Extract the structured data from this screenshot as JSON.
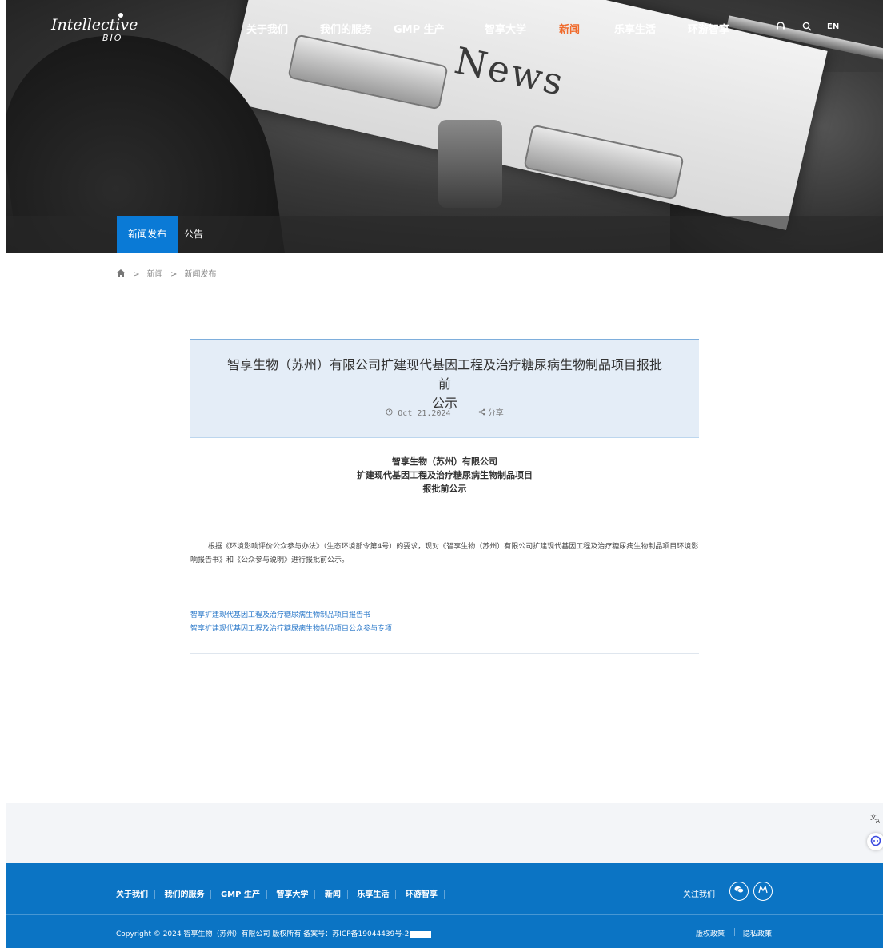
{
  "header": {
    "logo": {
      "text": "Intellective",
      "sub": "BIO"
    },
    "nav": [
      {
        "label": "关于我们",
        "active": false
      },
      {
        "label": "我们的服务",
        "active": false
      },
      {
        "label": "GMP 生产",
        "active": false
      },
      {
        "label": "智享大学",
        "active": false
      },
      {
        "label": "新闻",
        "active": true
      },
      {
        "label": "乐享生活",
        "active": false
      },
      {
        "label": "环游智享",
        "active": false
      }
    ],
    "icons": [
      "headset-icon",
      "search-icon"
    ],
    "lang": "EN",
    "accent_color": "#f06a2b"
  },
  "hero": {
    "word": "News"
  },
  "subnav": [
    {
      "label": "新闻发布",
      "active": true
    },
    {
      "label": "公告",
      "active": false
    }
  ],
  "breadcrumb": {
    "items": [
      "新闻",
      "新闻发布"
    ],
    "separator": ">"
  },
  "article": {
    "title_line1": "智享生物（苏州）有限公司扩建现代基因工程及治疗糖尿病生物制品项目报批前",
    "title_line2": "公示",
    "date": "Oct 21.2024",
    "share_label": "分享",
    "subtitle": [
      "智享生物（苏州）有限公司",
      "扩建现代基因工程及治疗糖尿病生物制品项目",
      "报批前公示"
    ],
    "body": "根据《环境影响评价公众参与办法》（生态环境部令第4号）的要求，现对《智享生物（苏州）有限公司扩建现代基因工程及治疗糖尿病生物制品项目环境影响报告书》和《公众参与说明》进行报批前公示。",
    "links": [
      "智享扩建现代基因工程及治疗糖尿病生物制品项目报告书",
      "智享扩建现代基因工程及治疗糖尿病生物制品项目公众参与专项"
    ]
  },
  "footer": {
    "nav": [
      "关于我们",
      "我们的服务",
      "GMP 生产",
      "智享大学",
      "新闻",
      "乐享生活",
      "环游智享"
    ],
    "follow_label": "关注我们",
    "social": [
      "wechat-icon",
      "weibo-icon"
    ],
    "copyright": "Copyright © 2024 智享生物（苏州）有限公司 版权所有 备案号：苏ICP备19044439号-2",
    "policies": [
      "版权政策",
      "隐私政策"
    ],
    "brand_color": "#0b74c4"
  }
}
